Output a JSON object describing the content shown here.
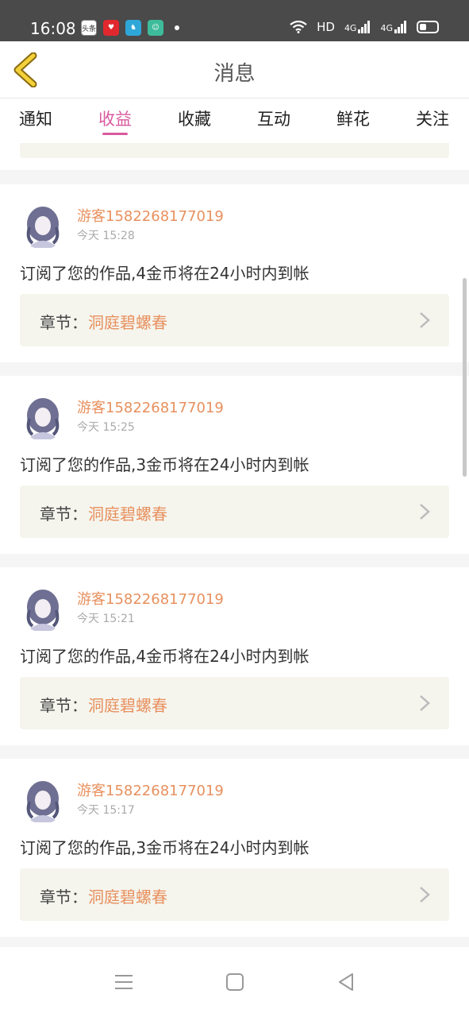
{
  "status_bar": {
    "time": "16:08",
    "network": "HD",
    "signal_1": "4G",
    "signal_2": "4G",
    "apps": [
      {
        "icon": "toutiao-icon",
        "text": "头条",
        "color": "#ffffff"
      },
      {
        "icon": "heart-app-icon",
        "text": "",
        "color": "#e0282e"
      },
      {
        "icon": "camel-app-icon",
        "text": "",
        "color": "#2ea6d8"
      },
      {
        "icon": "green-app-icon",
        "text": "",
        "color": "#3dbb9a"
      }
    ]
  },
  "header": {
    "title": "消息"
  },
  "tabs": [
    {
      "label": "通知",
      "active": false
    },
    {
      "label": "收益",
      "active": true
    },
    {
      "label": "收藏",
      "active": false
    },
    {
      "label": "互动",
      "active": false
    },
    {
      "label": "鲜花",
      "active": false
    },
    {
      "label": "关注",
      "active": false
    }
  ],
  "messages": [
    {
      "username": "游客1582268177019",
      "time": "今天 15:28",
      "text": "订阅了您的作品,4金币将在24小时内到帐",
      "chapter_label": "章节：",
      "chapter_name": "洞庭碧螺春"
    },
    {
      "username": "游客1582268177019",
      "time": "今天 15:25",
      "text": "订阅了您的作品,3金币将在24小时内到帐",
      "chapter_label": "章节：",
      "chapter_name": "洞庭碧螺春"
    },
    {
      "username": "游客1582268177019",
      "time": "今天 15:21",
      "text": "订阅了您的作品,4金币将在24小时内到帐",
      "chapter_label": "章节：",
      "chapter_name": "洞庭碧螺春"
    },
    {
      "username": "游客1582268177019",
      "time": "今天 15:17",
      "text": "订阅了您的作品,3金币将在24小时内到帐",
      "chapter_label": "章节：",
      "chapter_name": "洞庭碧螺春"
    }
  ],
  "colors": {
    "accent": "#d95a9e",
    "username": "#e8905e",
    "chapter_bg": "#f5f5ee"
  }
}
